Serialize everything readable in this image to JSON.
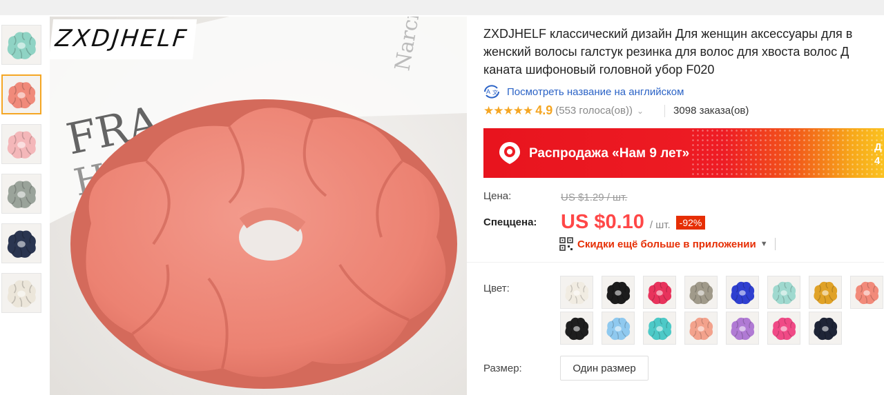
{
  "brand_logo": "ZXDJHELF",
  "product": {
    "title_lines": [
      "ZXDJHELF классический дизайн Для женщин аксессуары для в",
      "женский волосы галстук резинка для волос для хвоста волос Д",
      "каната шифоновый головной убор F020"
    ],
    "translate_link": "Посмотреть название на английском",
    "stars": "★★★★★",
    "rating": "4.9",
    "votes": "(553 голоса(ов))",
    "orders": "3098 заказа(ов)"
  },
  "banner": {
    "text": "Распродажа «Нам 9 лет»",
    "right_line1": "Д",
    "right_line2": "4"
  },
  "price": {
    "label": "Цена:",
    "old": "US $1.29 / шт.",
    "special_label": "Спеццена:",
    "new": "US $0.10",
    "unit": "/ шт.",
    "discount": "-92%",
    "app_discount": "Скидки ещё больше в приложении"
  },
  "options": {
    "color_label": "Цвет:",
    "size_label": "Размер:",
    "size_value": "Один размер"
  },
  "colors": {
    "thumbs": [
      "#8fd3c4",
      "#f08a7a",
      "#f4b7b9",
      "#9aa39a",
      "#2a3550",
      "#ece6da"
    ],
    "swatches_row1": [
      "#f1ece2",
      "#1c1c1c",
      "#e8335c",
      "#a09a8a",
      "#2f3fd0",
      "#9fd9cf",
      "#e0a227",
      "#f28a7a"
    ],
    "swatches_row2": [
      "#1e1e1e",
      "#8fc9ef",
      "#4dc9c7",
      "#f3a28c",
      "#b07ad4",
      "#f04a86",
      "#1e2436"
    ],
    "accent_red": "#ff4747",
    "link_blue": "#2b63c6",
    "star_orange": "#f5a623"
  }
}
